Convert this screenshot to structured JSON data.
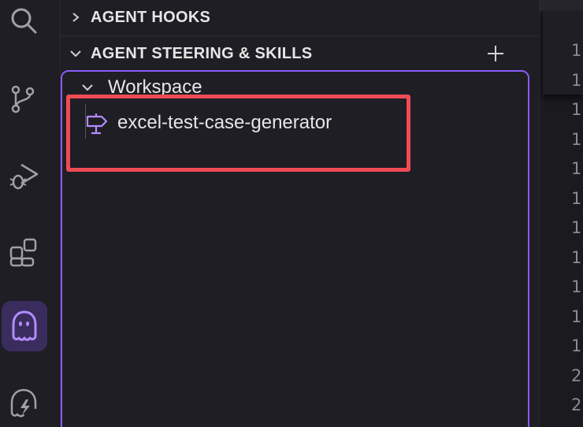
{
  "activity_bar": {
    "icons": [
      {
        "name": "search-icon"
      },
      {
        "name": "source-control-icon"
      },
      {
        "name": "run-debug-icon"
      },
      {
        "name": "extensions-icon"
      },
      {
        "name": "kiro-ghost-icon",
        "active": true
      },
      {
        "name": "kiro-lightning-icon"
      }
    ]
  },
  "sections": {
    "agent_hooks": {
      "title": "AGENT HOOKS"
    },
    "agent_steering": {
      "title": "AGENT STEERING & SKILLS"
    }
  },
  "tree": {
    "workspace_label": "Workspace",
    "items": [
      {
        "label": "excel-test-case-generator",
        "icon": "signpost-icon"
      }
    ]
  },
  "editor": {
    "line_numbers": [
      "1",
      "1",
      "1",
      "1",
      "1",
      "1",
      "1",
      "1",
      "1",
      "1",
      "1",
      "2",
      "2",
      "2"
    ]
  },
  "colors": {
    "accent": "#8a5cf6",
    "highlight": "#ef4b55",
    "background": "#1e1e24"
  }
}
